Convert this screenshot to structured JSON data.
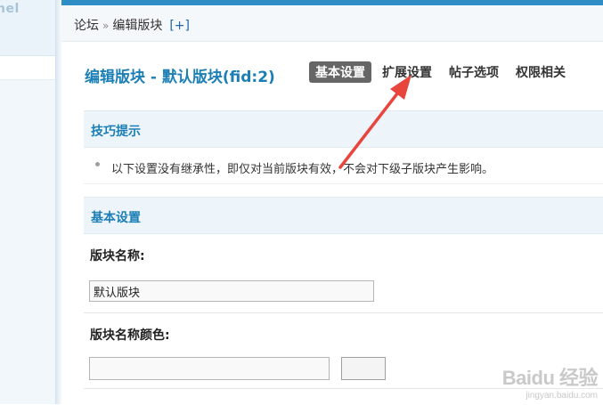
{
  "sidebar": {
    "panel_label": "nel"
  },
  "breadcrumb": {
    "forum": "论坛",
    "separator": "»",
    "current": "编辑版块",
    "add": "[+]"
  },
  "page": {
    "title": "编辑版块 - 默认版块(fid:2)"
  },
  "tabs": [
    {
      "label": "基本设置",
      "active": true
    },
    {
      "label": "扩展设置",
      "active": false
    },
    {
      "label": "帖子选项",
      "active": false
    },
    {
      "label": "权限相关",
      "active": false
    }
  ],
  "tips": {
    "header": "技巧提示",
    "text": "以下设置没有继承性，即仅对当前版块有效，不会对下级子版块产生影响。"
  },
  "basic": {
    "header": "基本设置",
    "name_label": "版块名称:",
    "name_value": "默认版块",
    "color_label": "版块名称颜色:",
    "color_value": ""
  },
  "annotation": {
    "color": "#e8453c",
    "points_to": "扩展设置"
  },
  "watermark": {
    "logo": "Baidu 经验",
    "url": "jingyan.baidu.com"
  },
  "colors": {
    "accent": "#1b7fb6",
    "topbar": "#2f8dc5",
    "active_tab_bg": "#666666"
  }
}
